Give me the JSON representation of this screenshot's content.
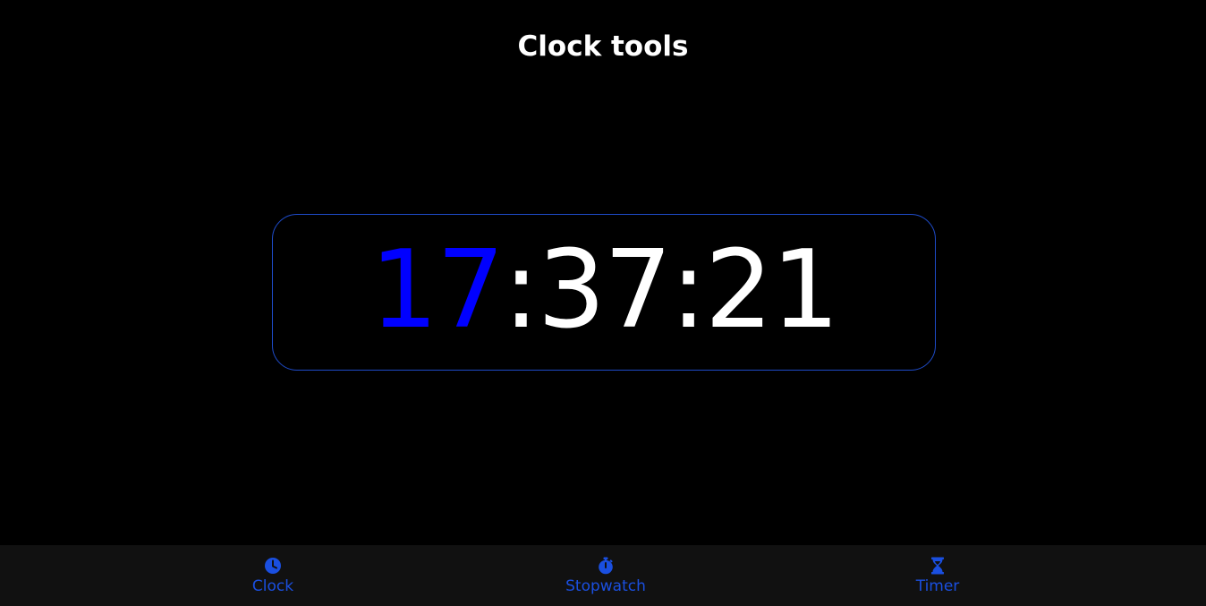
{
  "header": {
    "title": "Clock tools"
  },
  "clock": {
    "hours": "17",
    "separator": ":",
    "minutes": "37",
    "seconds": "21",
    "hours_color": "#0000ff",
    "digits_color": "#ffffff",
    "border_color": "#1e4bc8"
  },
  "nav": {
    "accent_color": "#1a4fe0",
    "items": [
      {
        "label": "Clock",
        "icon": "clock-icon"
      },
      {
        "label": "Stopwatch",
        "icon": "stopwatch-icon"
      },
      {
        "label": "Timer",
        "icon": "hourglass-icon"
      }
    ]
  }
}
